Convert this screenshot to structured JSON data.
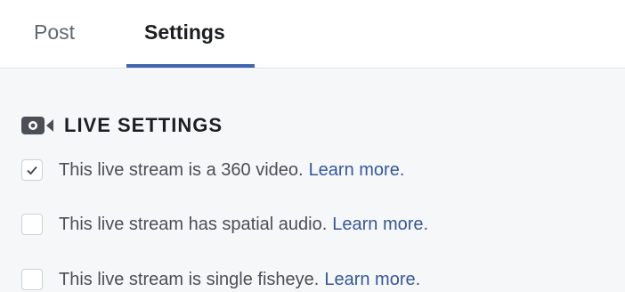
{
  "tabs": {
    "post_label": "Post",
    "settings_label": "Settings",
    "active": "Settings"
  },
  "section": {
    "icon": "live-video-camera-icon",
    "title": "LIVE SETTINGS"
  },
  "options": [
    {
      "label": "This live stream is a 360 video.",
      "link": "Learn more.",
      "checked": true
    },
    {
      "label": "This live stream has spatial audio.",
      "link": "Learn more.",
      "checked": false
    },
    {
      "label": "This live stream is single fisheye.",
      "link": "Learn more.",
      "checked": false
    }
  ],
  "colors": {
    "accent": "#4267b2",
    "link": "#365899",
    "text": "#4b4f56",
    "background": "#f6f7f9"
  }
}
